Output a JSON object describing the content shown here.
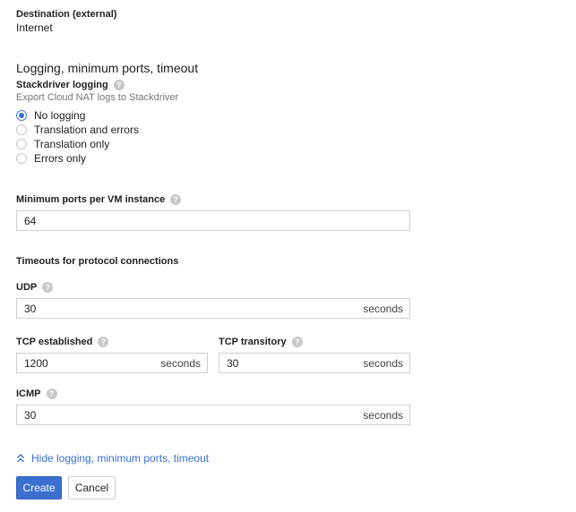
{
  "destination": {
    "label": "Destination (external)",
    "value": "Internet"
  },
  "section": {
    "title": "Logging, minimum ports, timeout"
  },
  "logging": {
    "label": "Stackdriver logging",
    "help_icon": "?",
    "description": "Export Cloud NAT logs to Stackdriver",
    "options": [
      {
        "label": "No logging",
        "selected": true
      },
      {
        "label": "Translation and errors",
        "selected": false
      },
      {
        "label": "Translation only",
        "selected": false
      },
      {
        "label": "Errors only",
        "selected": false
      }
    ]
  },
  "min_ports": {
    "label": "Minimum ports per VM instance",
    "help_icon": "?",
    "value": "64"
  },
  "timeouts": {
    "heading": "Timeouts for protocol connections",
    "udp": {
      "label": "UDP",
      "help_icon": "?",
      "value": "30",
      "unit": "seconds"
    },
    "tcp_established": {
      "label": "TCP established",
      "help_icon": "?",
      "value": "1200",
      "unit": "seconds"
    },
    "tcp_transitory": {
      "label": "TCP transitory",
      "help_icon": "?",
      "value": "30",
      "unit": "seconds"
    },
    "icmp": {
      "label": "ICMP",
      "help_icon": "?",
      "value": "30",
      "unit": "seconds"
    }
  },
  "toggle_link": {
    "icon": "chevron-double-up-icon",
    "label": "Hide logging, minimum ports, timeout"
  },
  "actions": {
    "create_label": "Create",
    "cancel_label": "Cancel"
  },
  "colors": {
    "accent": "#3b6fd0",
    "text": "#212121",
    "hint": "#757575",
    "border": "#cfcfcf"
  }
}
